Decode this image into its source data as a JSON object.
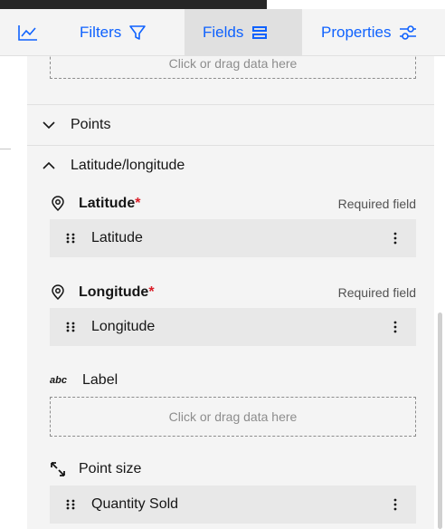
{
  "tabs": {
    "visualization_icon": "chart-line-icon",
    "filters": "Filters",
    "fields": "Fields",
    "properties": "Properties"
  },
  "dropzone_top": "Click or drag data here",
  "sections": {
    "points": "Points",
    "latlong": "Latitude/longitude"
  },
  "latitude": {
    "label": "Latitude",
    "required_marker": "*",
    "required_text": "Required field",
    "value": "Latitude"
  },
  "longitude": {
    "label": "Longitude",
    "required_marker": "*",
    "required_text": "Required field",
    "value": "Longitude"
  },
  "label_field": {
    "icon_text": "abc",
    "label": "Label",
    "dropzone": "Click or drag data here"
  },
  "point_size": {
    "label": "Point size",
    "value": "Quantity Sold"
  },
  "colors": {
    "accent": "#0f62fe",
    "required": "#da1e28"
  }
}
